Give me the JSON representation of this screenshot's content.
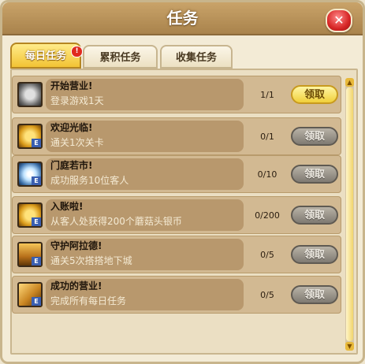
{
  "window": {
    "title": "任务"
  },
  "tabs": [
    {
      "label": "每日任务",
      "active": true,
      "badge": "!"
    },
    {
      "label": "累积任务",
      "active": false
    },
    {
      "label": "收集任务",
      "active": false
    }
  ],
  "tasks": [
    {
      "name": "开始营业!",
      "desc": "登录游戏1天",
      "progress": "1/1",
      "button": "领取",
      "claimable": true,
      "icon": "coin-icon"
    },
    {
      "name": "欢迎光临!",
      "desc": "通关1次关卡",
      "progress": "0/1",
      "button": "领取",
      "claimable": false,
      "icon": "coin-icon"
    },
    {
      "name": "门庭若市!",
      "desc": "成功服务10位客人",
      "progress": "0/10",
      "button": "领取",
      "claimable": false,
      "icon": "star-burst-icon"
    },
    {
      "name": "入账啦!",
      "desc": "从客人处获得200个蘑菇头银币",
      "progress": "0/200",
      "button": "领取",
      "claimable": false,
      "icon": "coin-icon"
    },
    {
      "name": "守护阿拉德!",
      "desc": "通关5次搭搭地下城",
      "progress": "0/5",
      "button": "领取",
      "claimable": false,
      "icon": "treasure-chest-icon"
    },
    {
      "name": "成功的营业!",
      "desc": "完成所有每日任务",
      "progress": "0/5",
      "button": "领取",
      "claimable": false,
      "icon": "trophy-icon"
    }
  ],
  "colors": {
    "claim_active": "#f0cf3a",
    "claim_disabled": "#8c877f",
    "close": "#d72626"
  }
}
